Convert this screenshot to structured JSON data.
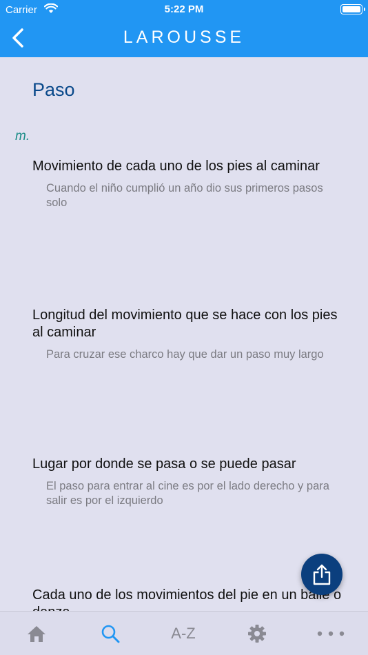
{
  "status_bar": {
    "carrier": "Carrier",
    "time": "5:22 PM"
  },
  "nav": {
    "title": "LAROUSSE",
    "back_icon": "chevron-left-icon"
  },
  "entry": {
    "headword": "Paso",
    "part_of_speech": "m.",
    "senses": [
      {
        "definition": "Movimiento de cada uno de los pies al caminar",
        "example": "Cuando el niño cumplió un año dio sus primeros pasos solo"
      },
      {
        "definition": "Longitud del movimiento que se hace con los pies al caminar",
        "example": "Para cruzar ese charco hay que dar un paso muy largo"
      },
      {
        "definition": "Lugar por donde se pasa o se puede pasar",
        "example": "El paso para entrar al cine es por el lado derecho y para salir es por el izquierdo"
      },
      {
        "definition": "Cada uno de los movimientos del pie en un baile o danza",
        "example": ""
      }
    ]
  },
  "fab": {
    "icon": "share-icon"
  },
  "tab_bar": {
    "home_icon": "home-icon",
    "search_icon": "search-icon",
    "az_label": "A-Z",
    "settings_icon": "gear-icon",
    "more_icon": "more-icon",
    "active_color": "#2196f3",
    "inactive_color": "#8a8a93"
  },
  "colors": {
    "brand": "#2196f3",
    "headword": "#0b4a8b",
    "pos": "#1a8c86",
    "fab": "#0b3f7e"
  }
}
